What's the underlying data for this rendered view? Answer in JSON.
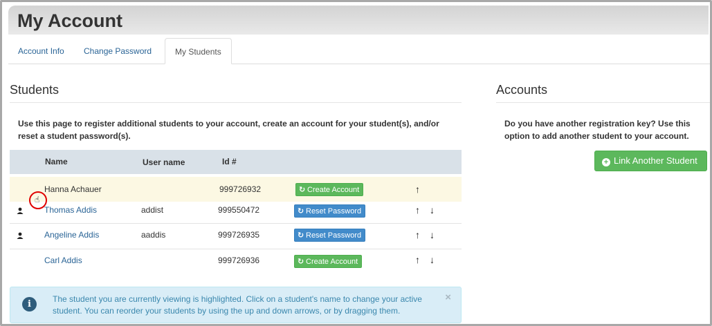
{
  "header": {
    "title": "My Account"
  },
  "tabs": [
    {
      "label": "Account Info",
      "active": false
    },
    {
      "label": "Change Password",
      "active": false
    },
    {
      "label": "My Students",
      "active": true
    }
  ],
  "students": {
    "heading": "Students",
    "intro": "Use this page to register additional students to your account, create an account for your student(s), and/or reset a student password(s).",
    "columns": {
      "name": "Name",
      "username": "User name",
      "id": "Id #"
    },
    "rows": [
      {
        "name": "Hanna Achauer",
        "username": "",
        "id": "999726932",
        "action": "Create Account",
        "has_user_icon": false,
        "highlighted": true,
        "link": false
      },
      {
        "name": "Thomas Addis",
        "username": "addist",
        "id": "999550472",
        "action": "Reset Password",
        "has_user_icon": true,
        "highlighted": false,
        "link": true
      },
      {
        "name": "Angeline Addis",
        "username": "aaddis",
        "id": "999726935",
        "action": "Reset Password",
        "has_user_icon": true,
        "highlighted": false,
        "link": true
      },
      {
        "name": "Carl Addis",
        "username": "",
        "id": "999726936",
        "action": "Create Account",
        "has_user_icon": false,
        "highlighted": false,
        "link": true
      }
    ],
    "info": "The student you are currently viewing is highlighted. Click on a student's name to change your active student. You can reorder your students by using the up and down arrows, or by dragging them."
  },
  "accounts": {
    "heading": "Accounts",
    "text": "Do you have another registration key? Use this option to add another student to your account.",
    "button_label": "Link Another Student"
  },
  "symbols": {
    "up": "↑",
    "down": "↓",
    "close": "×",
    "info": "i",
    "refresh": "↻",
    "plus": "+"
  },
  "colors": {
    "link": "#2a6496",
    "green": "#5cb85c",
    "blue": "#428bca",
    "highlight": "#fcf8e3",
    "table_head": "#d9e1e8",
    "info_bg": "#d9edf7",
    "info_text": "#3a87ad"
  }
}
